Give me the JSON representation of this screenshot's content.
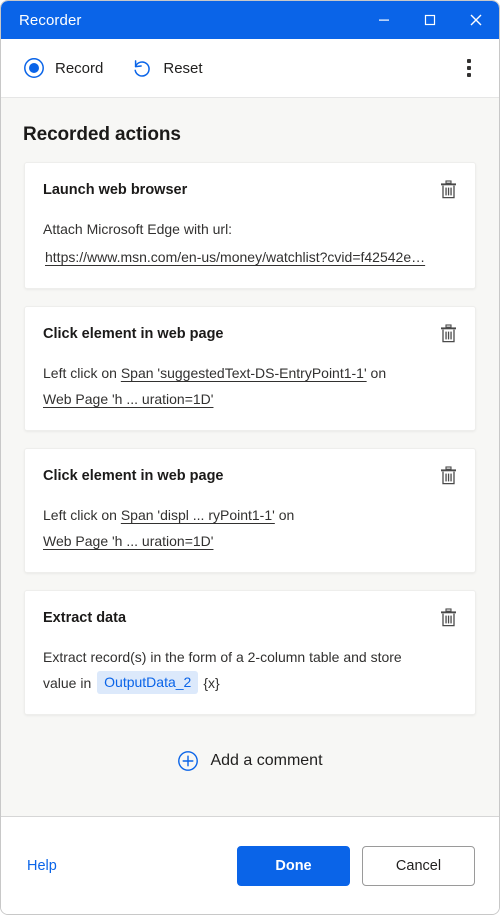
{
  "window": {
    "title": "Recorder",
    "accent_color": "#0a64e8",
    "controls": {
      "minimize": "minimize-button",
      "maximize": "maximize-button",
      "close": "close-button"
    }
  },
  "toolbar": {
    "record_label": "Record",
    "reset_label": "Reset",
    "more_label": "More options"
  },
  "main": {
    "section_title": "Recorded actions",
    "actions": [
      {
        "title": "Launch web browser",
        "desc_prefix": "Attach Microsoft Edge with url:",
        "url": "https://www.msn.com/en-us/money/watchlist?cvid=f42542e…",
        "delete_label": "delete"
      },
      {
        "title": "Click element in web page",
        "line1_prefix": "Left click on",
        "line1_target": "Span 'suggestedText-DS-EntryPoint1-1'",
        "line1_suffix": "on",
        "line2_target": "Web Page 'h ... uration=1D'",
        "delete_label": "delete"
      },
      {
        "title": "Click element in web page",
        "line1_prefix": "Left click on",
        "line1_target": "Span 'displ ... ryPoint1-1'",
        "line1_suffix": "on",
        "line2_target": "Web Page 'h ... uration=1D'",
        "delete_label": "delete"
      },
      {
        "title": "Extract data",
        "desc_line1": "Extract record(s) in the form of a 2-column table and store",
        "desc_line2": "value in",
        "variable_chip": "OutputData_2",
        "variable_symbol": "{x}",
        "delete_label": "delete"
      }
    ],
    "add_comment_label": "Add a comment"
  },
  "footer": {
    "help_label": "Help",
    "done_label": "Done",
    "cancel_label": "Cancel"
  }
}
